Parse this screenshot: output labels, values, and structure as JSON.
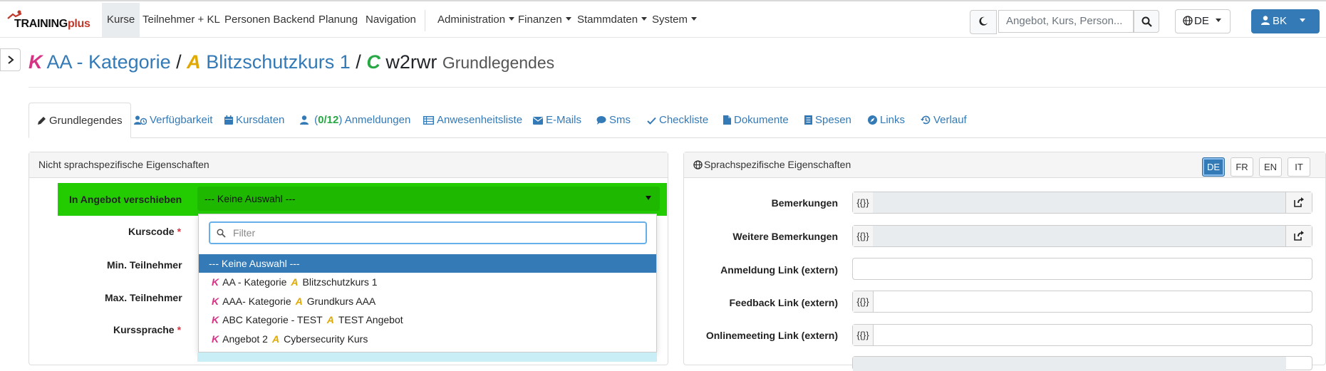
{
  "nav": {
    "logo_training": "TRAINING",
    "logo_plus": "plus",
    "items": [
      "Kurse",
      "Teilnehmer + KL",
      "Personen Backend",
      "Planung",
      "Navigation"
    ],
    "menus": [
      "Administration",
      "Finanzen",
      "Stammdaten",
      "System"
    ],
    "search_placeholder": "Angebot, Kurs, Person...",
    "lang": "DE",
    "user": "BK"
  },
  "header": {
    "k_letter": "K",
    "k_name": "AA - Kategorie",
    "sep1": "/",
    "a_letter": "A",
    "a_name": "Blitzschutzkurs 1",
    "sep2": "/",
    "c_letter": "C",
    "c_name": "w2rwr",
    "subtitle": "Grundlegendes"
  },
  "tabs": {
    "grundlegendes": "Grundlegendes",
    "verfuegbarkeit": "Verfügbarkeit",
    "kursdaten": "Kursdaten",
    "anmeldungen_open": "(",
    "anmeldungen_count": "0/12",
    "anmeldungen_label": ") Anmeldungen",
    "anwesenheitsliste": "Anwesenheitsliste",
    "emails": "E-Mails",
    "sms": "Sms",
    "checkliste": "Checkliste",
    "dokumente": "Dokumente",
    "spesen": "Spesen",
    "links": "Links",
    "verlauf": "Verlauf"
  },
  "left_panel": {
    "title": "Nicht sprachspezifische Eigenschaften",
    "move_label": "In Angebot verschieben",
    "move_value": "--- Keine Auswahl ---",
    "kurscode": "Kurscode",
    "min_teilnehmer": "Min. Teilnehmer",
    "max_teilnehmer": "Max. Teilnehmer",
    "kurssprache": "Kurssprache",
    "required_mark": "*"
  },
  "dropdown": {
    "filter_placeholder": "Filter",
    "selected": "--- Keine Auswahl ---",
    "options": [
      {
        "k": "K",
        "kategorie": "AA - Kategorie",
        "a": "A",
        "angebot": "Blitzschutzkurs 1"
      },
      {
        "k": "K",
        "kategorie": "AAA- Kategorie",
        "a": "A",
        "angebot": "Grundkurs AAA"
      },
      {
        "k": "K",
        "kategorie": "ABC Kategorie - TEST",
        "a": "A",
        "angebot": "TEST Angebot"
      },
      {
        "k": "K",
        "kategorie": "Angebot 2",
        "a": "A",
        "angebot": "Cybersecurity Kurs"
      }
    ]
  },
  "right_panel": {
    "title": "Sprachspezifische Eigenschaften",
    "languages": [
      "DE",
      "FR",
      "EN",
      "IT"
    ],
    "active_language": "DE",
    "bemerkungen": "Bemerkungen",
    "weitere_bemerkungen": "Weitere Bemerkungen",
    "anmeldung_link": "Anmeldung Link (extern)",
    "feedback_link": "Feedback Link (extern)",
    "onlinemeeting_link": "Onlinemeeting Link (extern)",
    "placeholder_prefix": "{{}}"
  },
  "colors": {
    "link_blue": "#337ab7",
    "kategorie_magenta": "#d63384",
    "angebot_gold": "#e0a800",
    "kurs_green": "#28a745",
    "highlight_green": "#22cc00"
  }
}
